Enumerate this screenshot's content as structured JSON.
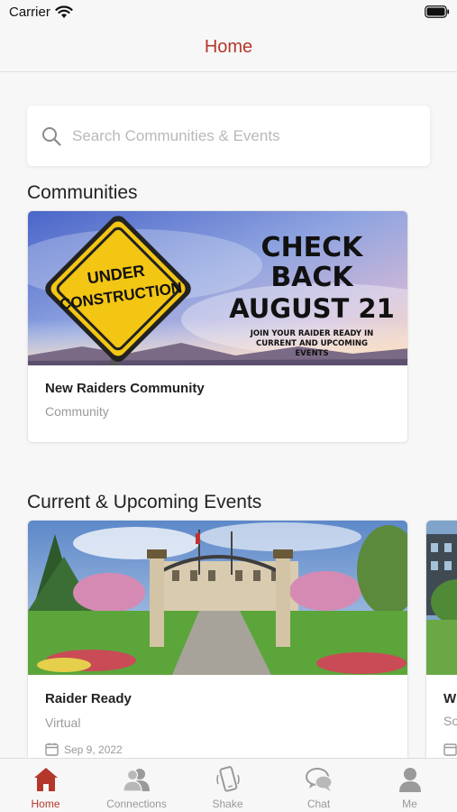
{
  "status_bar": {
    "carrier": "Carrier"
  },
  "nav": {
    "title": "Home"
  },
  "search": {
    "placeholder": "Search Communities & Events",
    "value": ""
  },
  "communities": {
    "heading": "Communities",
    "items": [
      {
        "banner": {
          "sign_line1": "UNDER",
          "sign_line2": "CONSTRUCTION",
          "headline1": "CHECK",
          "headline2": "BACK",
          "headline3": "AUGUST 21",
          "sub1": "JOIN YOUR RAIDER READY IN",
          "sub2": "CURRENT AND UPCOMING",
          "sub3": "EVENTS"
        },
        "title": "New Raiders Community",
        "type": "Community"
      }
    ]
  },
  "events": {
    "heading": "Current & Upcoming Events",
    "items": [
      {
        "title": "Raider Ready",
        "location": "Virtual",
        "date": "Sep 9, 2022"
      },
      {
        "title": "W",
        "location": "So",
        "date": ""
      }
    ]
  },
  "tabs": [
    {
      "label": "Home",
      "icon": "home-icon",
      "active": true
    },
    {
      "label": "Connections",
      "icon": "connections-icon",
      "active": false
    },
    {
      "label": "Shake",
      "icon": "shake-icon",
      "active": false
    },
    {
      "label": "Chat",
      "icon": "chat-icon",
      "active": false
    },
    {
      "label": "Me",
      "icon": "person-icon",
      "active": false
    }
  ],
  "colors": {
    "accent": "#b5372b",
    "inactive": "#999999",
    "sign_yellow": "#f3c614"
  }
}
